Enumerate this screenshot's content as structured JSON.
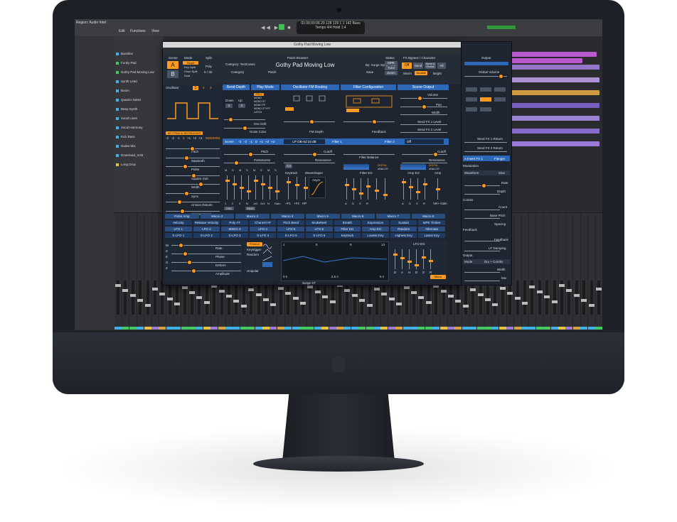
{
  "surge": {
    "window_title": "Gothy Pad Moving Low",
    "patch_browser_label": "Patch Browser",
    "patch_name": "Gothy Pad Moving Low",
    "category_label": "Category: TestCases",
    "author_label": "By: Surge Synth Team",
    "category_nav": "Category",
    "patch_nav": "Patch",
    "save_label": "Save",
    "scene_label": "Scene",
    "scene_a": "A",
    "scene_b": "B",
    "mode_label": "Mode",
    "mode_options": [
      "Single",
      "Key Split",
      "Chan Split",
      "Dual"
    ],
    "split_label": "Split",
    "poly_label": "Poly",
    "poly_value": "6 / 32",
    "status_label": "Status",
    "status_mpe": "MPE",
    "status_tune": "Tune",
    "status_zoom": "Zoom",
    "fx_label": "FX Bypass / Character",
    "fx_options": [
      "Off",
      "Send",
      "Send & Global",
      "All"
    ],
    "character_options": [
      "Warm",
      "Neutral",
      "Bright"
    ],
    "output_label": "Output",
    "global_volume": "Global Volume",
    "oscillator_label": "Oscillator",
    "osc_numbers": [
      "1",
      "2",
      "3"
    ],
    "bend_depth": "Bend Depth",
    "down_label": "Down",
    "up_label": "Up",
    "down_value": "2",
    "up_value": "2",
    "play_mode": "Play Mode",
    "play_modes": [
      "POLY",
      "MONO",
      "MONO ST",
      "MONO FP",
      "MONO ST+FP",
      "LATCH"
    ],
    "osc_drift": "Osc Drift",
    "noise_color": "Noise Color",
    "fm_routing": "Oscillator FM Routing",
    "fm_depth": "FM Depth",
    "filter_config": "Filter Configuration",
    "feedback": "Feedback",
    "scene_output": "Scene Output",
    "volume": "Volume",
    "pan": "Pan",
    "width": "Width",
    "send_fx1_level": "Send FX 1 Level",
    "send_fx2_level": "Send FX 2 Level",
    "send_fx1_return": "Send FX 1 Return",
    "send_fx2_return": "Send FX 2 Return",
    "keytrack_retrigger": "KEYTRACK RETRIGGER",
    "osc_octaves": [
      "-3",
      "-2",
      "-1",
      "0",
      "+1",
      "+2",
      "+3"
    ],
    "osc_type": "MODERN",
    "scene_row_label": "Scene",
    "scene_octaves": [
      "-3",
      "-2",
      "-1",
      "0",
      "+1",
      "+2",
      "+3"
    ],
    "filter1_type": "LP OB-Xd 24 dB",
    "filter1_label": "Filter 1",
    "filter2_label": "Filter 2",
    "filter2_type": "Off",
    "osc_params": [
      "Pitch",
      "Sawtooth",
      "Pulse",
      "Square Sub",
      "Width",
      "Sync",
      "Unison Detune",
      "Unison Voices"
    ],
    "scene_pitch": "Pitch",
    "portamento": "Portamento",
    "cutoff": "Cutoff",
    "resonance": "Resonance",
    "filter_balance": "Filter Balance",
    "keytrack": "Keytrack",
    "keytrack_value": "C4",
    "waveshaper": "Waveshaper",
    "asym": "Asym",
    "filter_eg": "Filter EG",
    "amp_eg": "Amp EG",
    "amp": "Amp",
    "digital": "DIGITAL",
    "analog": "ANALOG",
    "mixer_labels": [
      "M",
      "S",
      "M",
      "S",
      "M",
      "S",
      "M",
      "S",
      "M",
      "S",
      "M",
      "S"
    ],
    "mixer_bottom": [
      "1",
      "2",
      "3",
      "N",
      "1x2",
      "2x3",
      "N",
      "Gain"
    ],
    "osc_tab": "OSC",
    "ring_tab": "RING",
    "hp_label": "HP",
    "filter_sliders": [
      "+F1",
      "+F2"
    ],
    "eg_letters": [
      "A",
      "D",
      "S",
      "R"
    ],
    "vel_gain": "Vel+ Gain",
    "insert_fx": "A Insert FX 1",
    "fx_type": "Flanger",
    "modulation_label": "Modulation",
    "waveform": "Waveform",
    "waveform_value": "Sine",
    "rate": "Rate",
    "depth": "Depth",
    "combs_label": "Combs",
    "count": "Count",
    "base_pitch": "Base Pitch",
    "spacing": "Spacing",
    "feedback_label": "Feedback",
    "feedback_knob": "Feedback",
    "lf_damping": "LF Damping",
    "output_section": "Output",
    "output_mode": "Mode",
    "output_mode_value": "Dry + Combs",
    "out_width": "Width",
    "mix": "Mix",
    "macros": [
      "Pulse Amp",
      "Macro 2",
      "Macro 3",
      "Macro 4",
      "Macro 5",
      "Macro 6",
      "Macro 7",
      "Macro 8"
    ],
    "mod_row2": [
      "Velocity",
      "Release Velocity",
      "Poly AT",
      "Channel AT",
      "Pitch Bend",
      "Modwheel",
      "Breath",
      "Expression",
      "Sustain",
      "MPE Timbre"
    ],
    "mod_row3": [
      "LFO 1",
      "LFO 2",
      "MSEG 3",
      "LFO 4",
      "LFO 5",
      "LFO 6",
      "Filter EG",
      "Amp EG",
      "Random",
      "Alternate"
    ],
    "mod_row4": [
      "S-LFO 1",
      "S-LFO 2",
      "S-LFO 3",
      "S-LFO 4",
      "S-LFO 5",
      "S-LFO 6",
      "Keytrack",
      "Lowest Key",
      "Highest Key",
      "Latest Key"
    ],
    "lfo_params": [
      "Rate",
      "Phase",
      "Deform",
      "Amplitude"
    ],
    "lfo_modes": [
      "Freerun",
      "Keytrigger",
      "Random"
    ],
    "unipolar": "Unipolar",
    "lfo_eg": "LFO EG",
    "lfo_eg_letters": [
      "D",
      "A",
      "H",
      "D",
      "S",
      "R"
    ],
    "mseg_axis": [
      "1",
      "5",
      "9",
      "13"
    ],
    "mseg_time": [
      "0 s",
      "2.5 s",
      "5 s"
    ],
    "mseg_vertical": [
      "M",
      "S",
      "E",
      "G",
      "3"
    ],
    "menu": "Menu",
    "footer": "Surge XT"
  },
  "daw": {
    "inspector_title": "Region: Audio Intel",
    "tracks": [
      "Bassline",
      "Funky Pad",
      "Gothy Pad Moving Low",
      "Synth Lead",
      "Boom",
      "Quarter Notes",
      "Beep Synth",
      "Vocal Lines",
      "Vocal Harmony",
      "Kick Bass",
      "Guitar Mix",
      "Download_Vol3",
      "Long Drop"
    ],
    "track_colors": [
      "#3fb0e8",
      "#46c862",
      "#46c862",
      "#3fb0e8",
      "#3fb0e8",
      "#3fb0e8",
      "#3fb0e8",
      "#3fb0e8",
      "#3fb0e8",
      "#3fb0e8",
      "#3fb0e8",
      "#3fb0e8",
      "#e8c23f"
    ],
    "menus": [
      "Edit",
      "Functions",
      "View"
    ],
    "lcd_text": "01:00:00:06.29 128 129  1  1  142  Bass Tempo  4/4  Hold 1.4"
  },
  "colors": {
    "accent": "#ff9a1e",
    "blue": "#2d67b8",
    "panel": "#1f2935"
  }
}
